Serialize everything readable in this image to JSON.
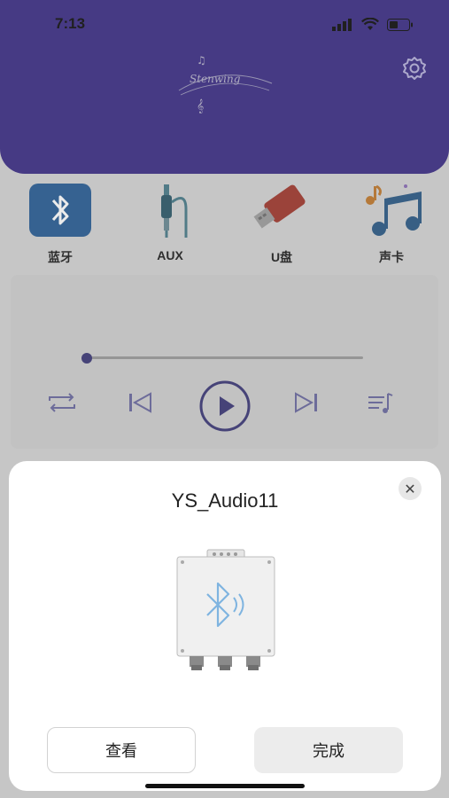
{
  "status_bar": {
    "time": "7:13"
  },
  "header": {
    "logo_text": "Stenwing",
    "settings_icon": "gear-icon",
    "brand_color": "#3e2f87"
  },
  "sources": [
    {
      "label": "蓝牙",
      "icon": "bluetooth-icon"
    },
    {
      "label": "AUX",
      "icon": "aux-cable-icon"
    },
    {
      "label": "U盘",
      "icon": "usb-drive-icon"
    },
    {
      "label": "声卡",
      "icon": "music-note-icon"
    }
  ],
  "player": {
    "progress": 0.0,
    "controls": [
      "repeat-icon",
      "previous-icon",
      "play-icon",
      "next-icon",
      "playlist-icon"
    ]
  },
  "dialog": {
    "title": "YS_Audio11",
    "close_icon": "close-icon",
    "device_icon": "bluetooth-module-icon",
    "view_button": "查看",
    "done_button": "完成"
  }
}
